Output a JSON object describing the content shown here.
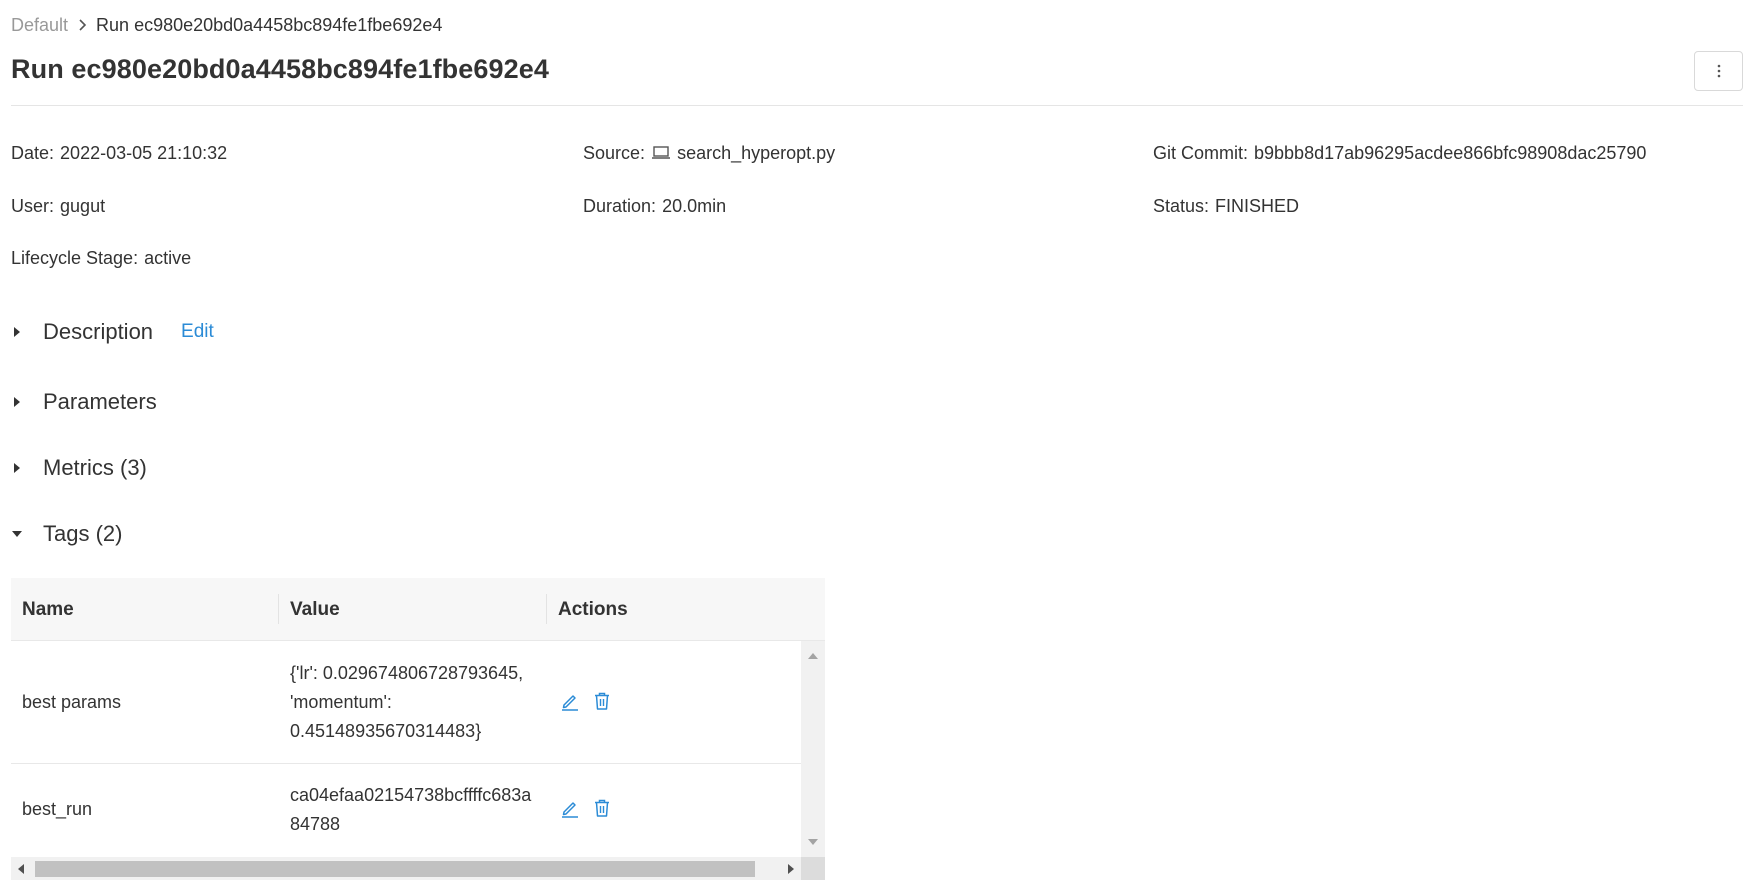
{
  "breadcrumb": {
    "root": "Default",
    "current": "Run ec980e20bd0a4458bc894fe1fbe692e4"
  },
  "page_title": "Run ec980e20bd0a4458bc894fe1fbe692e4",
  "kebab_icon": "more-vertical-icon",
  "metadata": {
    "separator": ":",
    "date": {
      "label": "Date",
      "value": "2022-03-05 21:10:32"
    },
    "source": {
      "label": "Source",
      "value": "search_hyperopt.py",
      "icon": "laptop-icon"
    },
    "git_commit": {
      "label": "Git Commit",
      "value": "b9bbb8d17ab96295acdee866bfc98908dac25790"
    },
    "user": {
      "label": "User",
      "value": "gugut"
    },
    "duration": {
      "label": "Duration",
      "value": "20.0min"
    },
    "status": {
      "label": "Status",
      "value": "FINISHED"
    },
    "lifecycle": {
      "label": "Lifecycle Stage",
      "value": "active"
    }
  },
  "sections": {
    "description": {
      "label": "Description",
      "edit_label": "Edit",
      "expanded": false
    },
    "parameters": {
      "label": "Parameters",
      "expanded": false
    },
    "metrics": {
      "label": "Metrics (3)",
      "expanded": false
    },
    "tags": {
      "label": "Tags (2)",
      "expanded": true
    }
  },
  "tags_table": {
    "columns": [
      "Name",
      "Value",
      "Actions"
    ],
    "rows": [
      {
        "name": "best params",
        "value_lines": [
          "{'lr': 0.029674806728793645,",
          "'momentum':",
          "0.45148935670314483}"
        ]
      },
      {
        "name": "best_run",
        "value_lines": [
          "ca04efaa02154738bcffffc683a",
          "84788"
        ]
      }
    ]
  },
  "colors": {
    "link": "#2b8bd6",
    "text": "#333333",
    "muted": "#999999",
    "header_bg": "#f7f7f7"
  }
}
